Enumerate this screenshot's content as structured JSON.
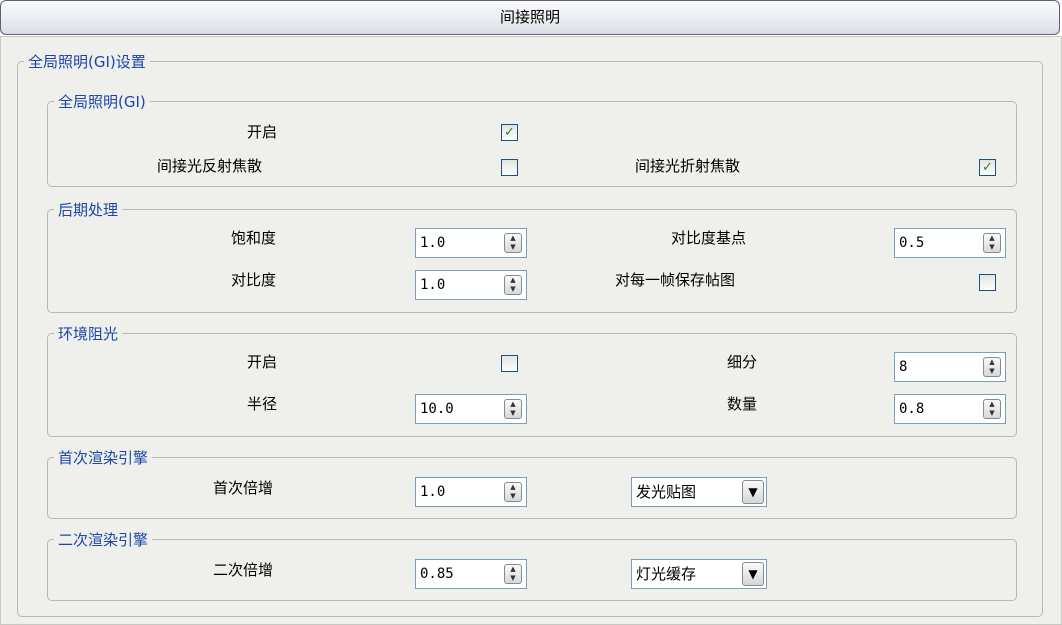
{
  "window": {
    "title": "间接照明"
  },
  "gi_settings": {
    "legend": "全局照明(GI)设置"
  },
  "gi": {
    "legend": "全局照明(GI)",
    "enable_label": "开启",
    "enable_checked": true,
    "refl_caustics_label": "间接光反射焦散",
    "refl_caustics_checked": false,
    "refr_caustics_label": "间接光折射焦散",
    "refr_caustics_checked": true
  },
  "post": {
    "legend": "后期处理",
    "saturation_label": "饱和度",
    "saturation_value": "1.0",
    "contrast_base_label": "对比度基点",
    "contrast_base_value": "0.5",
    "contrast_label": "对比度",
    "contrast_value": "1.0",
    "save_maps_label": "对每一帧保存帖图",
    "save_maps_checked": false
  },
  "ao": {
    "legend": "环境阻光",
    "enable_label": "开启",
    "enable_checked": false,
    "subdivs_label": "细分",
    "subdivs_value": "8",
    "radius_label": "半径",
    "radius_value": "10.0",
    "amount_label": "数量",
    "amount_value": "0.8"
  },
  "primary": {
    "legend": "首次渲染引擎",
    "multiplier_label": "首次倍增",
    "multiplier_value": "1.0",
    "engine_value": "发光贴图"
  },
  "secondary": {
    "legend": "二次渲染引擎",
    "multiplier_label": "二次倍增",
    "multiplier_value": "0.85",
    "engine_value": "灯光缓存"
  },
  "glyphs": {
    "check": "✓",
    "up": "▲",
    "down": "▼",
    "drop": "▼"
  }
}
